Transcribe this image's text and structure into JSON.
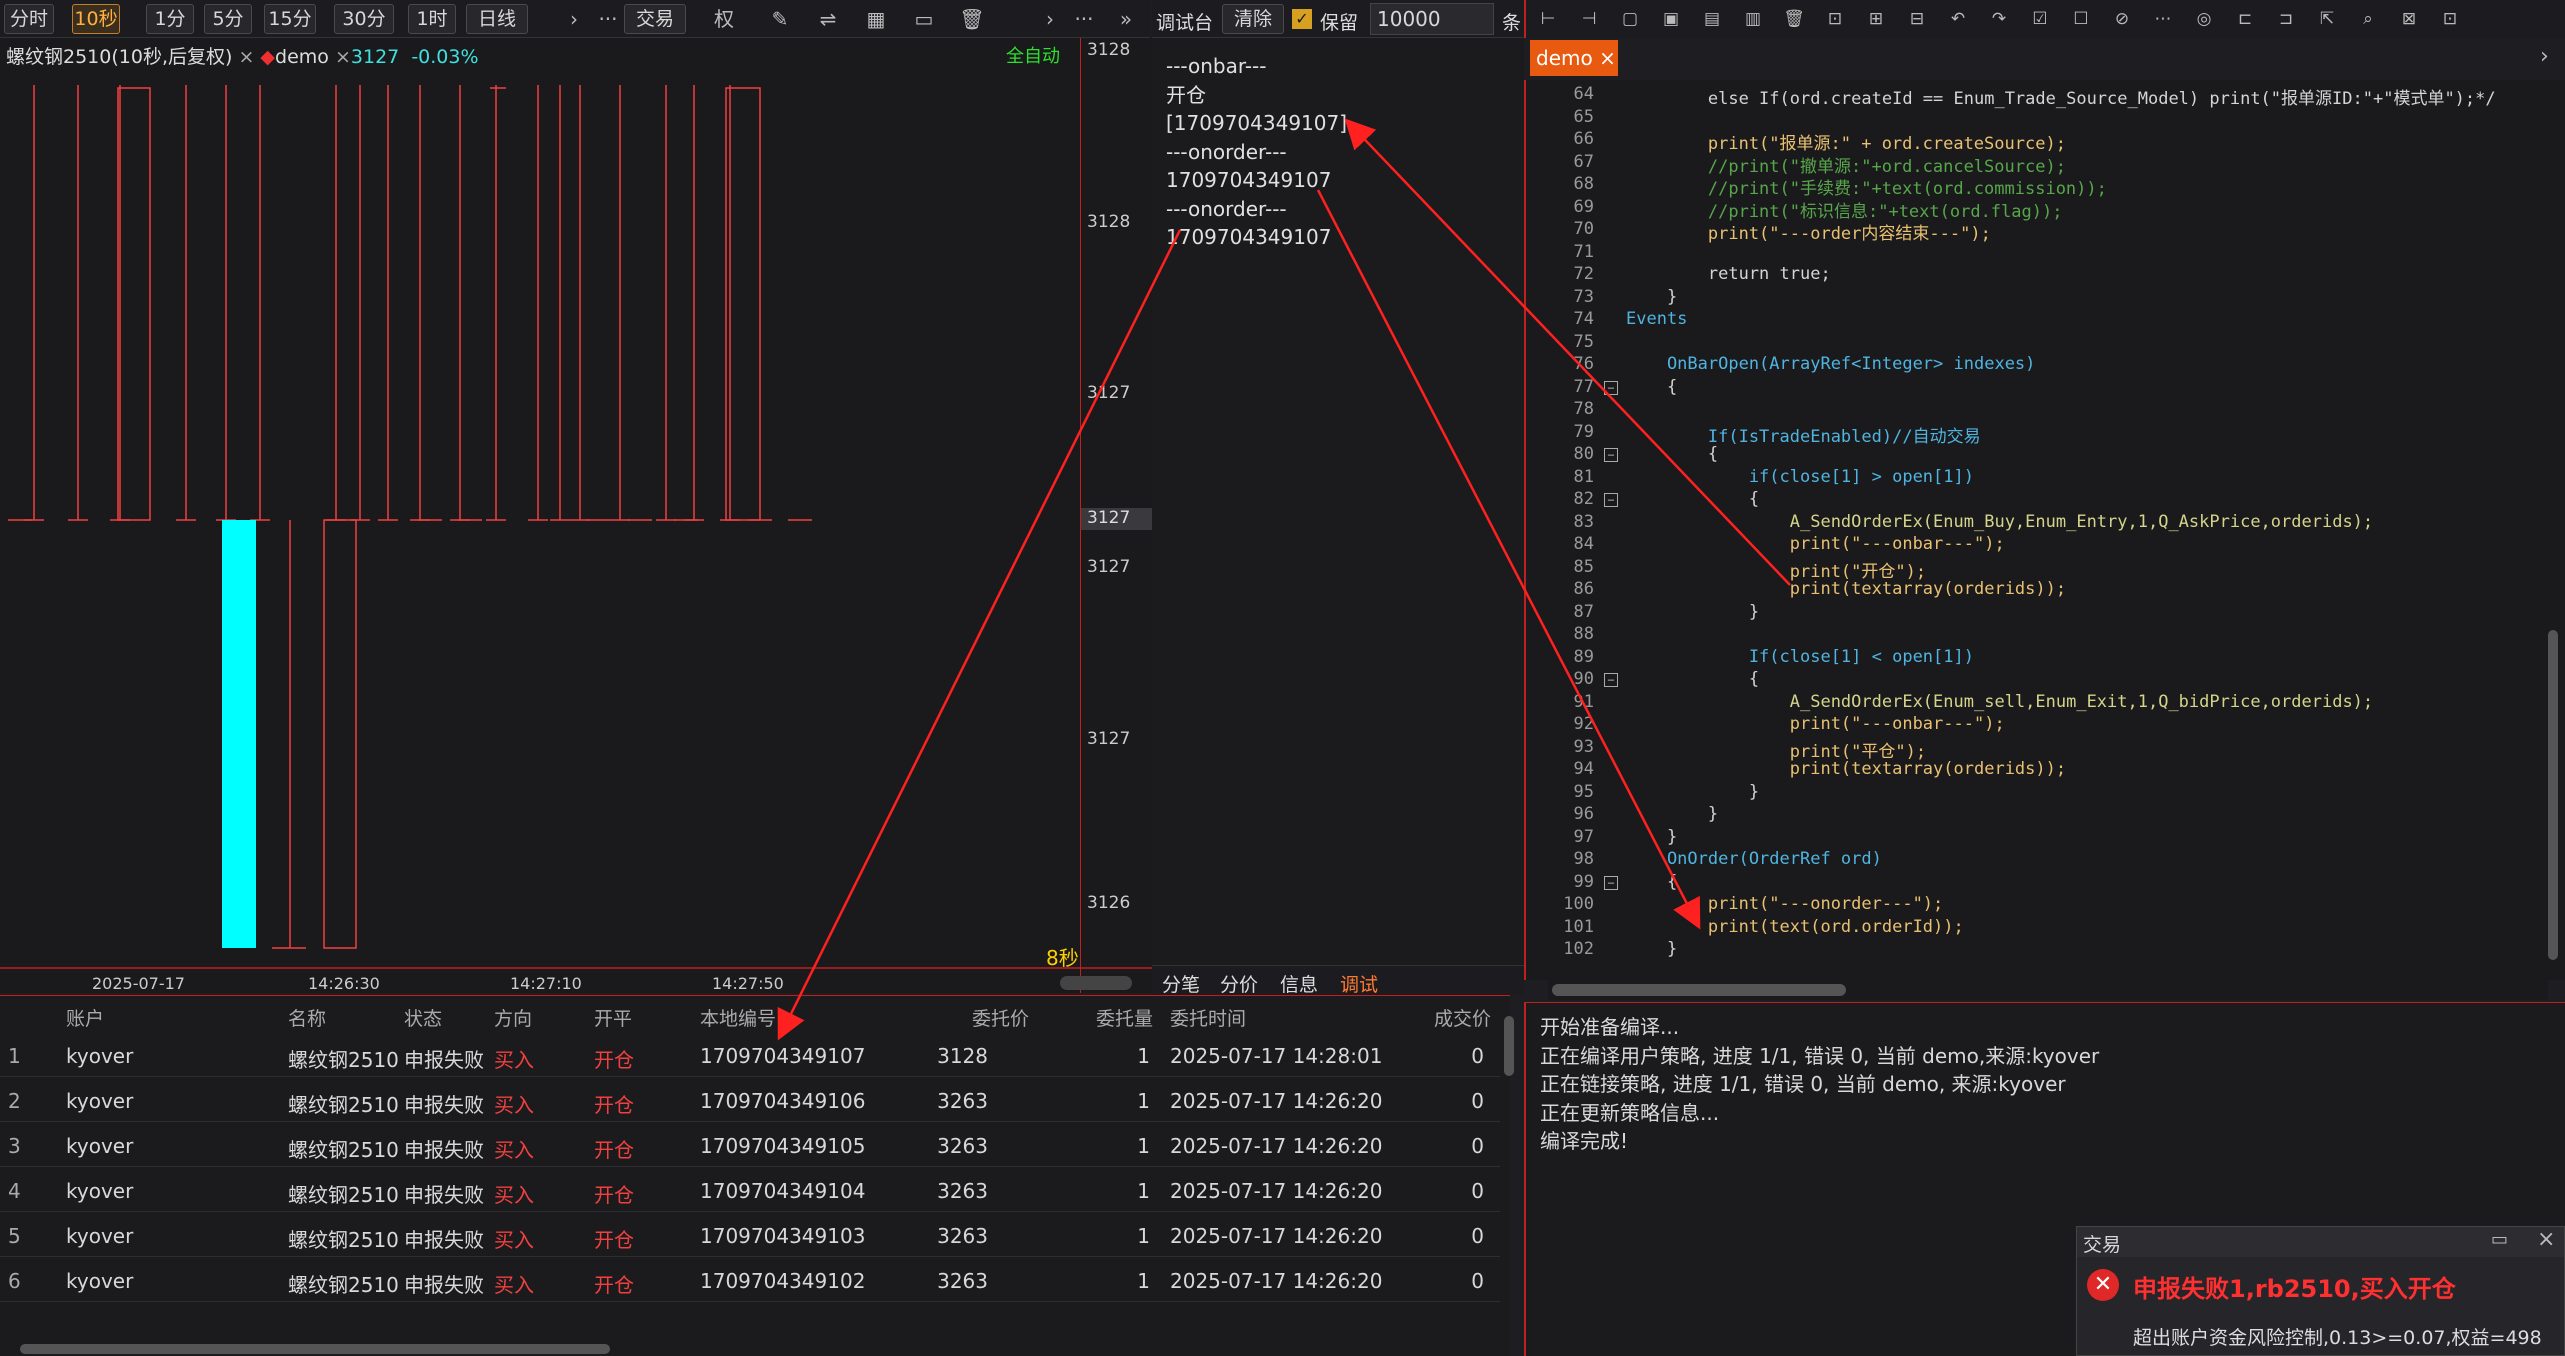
{
  "toolbar": {
    "periods": [
      "分时",
      "10秒",
      "1分",
      "5分",
      "15分",
      "30分",
      "1时",
      "日线"
    ],
    "active_period": "10秒",
    "trade_label": "交易",
    "rights_label": "权",
    "more": "···"
  },
  "chart": {
    "title": "螺纹钢2510(10秒,后复权)",
    "close": "×",
    "strategy": "demo",
    "price": "3127",
    "change": "-0.03%",
    "auto_label": "全自动",
    "timer": "8秒",
    "y_ticks": [
      "3128",
      "3128",
      "3127",
      "3127",
      "3127",
      "3126",
      "3126"
    ],
    "current_price": "3127",
    "x_ticks": [
      "2025-07-17",
      "14:26:30",
      "14:27:10",
      "14:27:50"
    ]
  },
  "debug": {
    "tab_label": "调试台",
    "clear_label": "清除",
    "keep_label": "保留",
    "keep_value": "10000",
    "unit_label": "条",
    "lines": [
      "---onbar---",
      "开仓",
      "[1709704349107]",
      "---onorder---",
      "1709704349107",
      "---onorder---",
      "1709704349107"
    ],
    "bottom_tabs": [
      "分笔",
      "分价",
      "信息",
      "调试"
    ]
  },
  "orders": {
    "headers": [
      "账户",
      "名称",
      "状态",
      "方向",
      "开平",
      "本地编号",
      "委托价",
      "委托量",
      "委托时间",
      "成交价"
    ],
    "rows": [
      {
        "idx": "1",
        "account": "kyover",
        "name": "螺纹钢2510",
        "status": "申报失败",
        "dir": "买入",
        "oc": "开仓",
        "local_id": "1709704349107",
        "price": "3128",
        "qty": "1",
        "time": "2025-07-17 14:28:01",
        "fill": "0"
      },
      {
        "idx": "2",
        "account": "kyover",
        "name": "螺纹钢2510",
        "status": "申报失败",
        "dir": "买入",
        "oc": "开仓",
        "local_id": "1709704349106",
        "price": "3263",
        "qty": "1",
        "time": "2025-07-17 14:26:20",
        "fill": "0"
      },
      {
        "idx": "3",
        "account": "kyover",
        "name": "螺纹钢2510",
        "status": "申报失败",
        "dir": "买入",
        "oc": "开仓",
        "local_id": "1709704349105",
        "price": "3263",
        "qty": "1",
        "time": "2025-07-17 14:26:20",
        "fill": "0"
      },
      {
        "idx": "4",
        "account": "kyover",
        "name": "螺纹钢2510",
        "status": "申报失败",
        "dir": "买入",
        "oc": "开仓",
        "local_id": "1709704349104",
        "price": "3263",
        "qty": "1",
        "time": "2025-07-17 14:26:20",
        "fill": "0"
      },
      {
        "idx": "5",
        "account": "kyover",
        "name": "螺纹钢2510",
        "status": "申报失败",
        "dir": "买入",
        "oc": "开仓",
        "local_id": "1709704349103",
        "price": "3263",
        "qty": "1",
        "time": "2025-07-17 14:26:20",
        "fill": "0"
      },
      {
        "idx": "6",
        "account": "kyover",
        "name": "螺纹钢2510",
        "status": "申报失败",
        "dir": "买入",
        "oc": "开仓",
        "local_id": "1709704349102",
        "price": "3263",
        "qty": "1",
        "time": "2025-07-17 14:26:20",
        "fill": "0"
      }
    ]
  },
  "editor": {
    "tab": "demo",
    "lines": [
      {
        "n": "64",
        "t": "        else If(ord.createId == Enum_Trade_Source_Model) print(\"报单源ID:\"+\"模式单\");*/"
      },
      {
        "n": "65",
        "t": ""
      },
      {
        "n": "66",
        "t": "        print(\"报单源:\" + ord.createSource);"
      },
      {
        "n": "67",
        "t": "        //print(\"撤单源:\"+ord.cancelSource);"
      },
      {
        "n": "68",
        "t": "        //print(\"手续费:\"+text(ord.commission));"
      },
      {
        "n": "69",
        "t": "        //print(\"标识信息:\"+text(ord.flag));"
      },
      {
        "n": "70",
        "t": "        print(\"---order内容结束---\");"
      },
      {
        "n": "71",
        "t": ""
      },
      {
        "n": "72",
        "t": "        return true;"
      },
      {
        "n": "73",
        "t": "    }"
      },
      {
        "n": "74",
        "t": "Events"
      },
      {
        "n": "75",
        "t": ""
      },
      {
        "n": "76",
        "t": "    OnBarOpen(ArrayRef<Integer> indexes)"
      },
      {
        "n": "77",
        "t": "    {"
      },
      {
        "n": "78",
        "t": ""
      },
      {
        "n": "79",
        "t": "        If(IsTradeEnabled)//自动交易"
      },
      {
        "n": "80",
        "t": "        {"
      },
      {
        "n": "81",
        "t": "            if(close[1] > open[1])"
      },
      {
        "n": "82",
        "t": "            {"
      },
      {
        "n": "83",
        "t": "                A_SendOrderEx(Enum_Buy,Enum_Entry,1,Q_AskPrice,orderids);"
      },
      {
        "n": "84",
        "t": "                print(\"---onbar---\");"
      },
      {
        "n": "85",
        "t": "                print(\"开仓\");"
      },
      {
        "n": "86",
        "t": "                print(textarray(orderids));"
      },
      {
        "n": "87",
        "t": "            }"
      },
      {
        "n": "88",
        "t": ""
      },
      {
        "n": "89",
        "t": "            If(close[1] < open[1])"
      },
      {
        "n": "90",
        "t": "            {"
      },
      {
        "n": "91",
        "t": "                A_SendOrderEx(Enum_sell,Enum_Exit,1,Q_bidPrice,orderids);"
      },
      {
        "n": "92",
        "t": "                print(\"---onbar---\");"
      },
      {
        "n": "93",
        "t": "                print(\"平仓\");"
      },
      {
        "n": "94",
        "t": "                print(textarray(orderids));"
      },
      {
        "n": "95",
        "t": "            }"
      },
      {
        "n": "96",
        "t": "        }"
      },
      {
        "n": "97",
        "t": "    }"
      },
      {
        "n": "98",
        "t": "    OnOrder(OrderRef ord)"
      },
      {
        "n": "99",
        "t": "    {"
      },
      {
        "n": "100",
        "t": "        print(\"---onorder---\");"
      },
      {
        "n": "101",
        "t": "        print(text(ord.orderId));"
      },
      {
        "n": "102",
        "t": "    }"
      }
    ]
  },
  "compile": {
    "lines": [
      "开始准备编译...",
      "正在编译用户策略, 进度 1/1, 错误 0, 当前 demo,来源:kyover",
      "正在链接策略, 进度 1/1, 错误 0, 当前 demo, 来源:kyover",
      "正在更新策略信息...",
      "编译完成!"
    ]
  },
  "trade_popup": {
    "title": "交易",
    "error": "申报失败1,rb2510,买入开仓",
    "detail": "超出账户资金风险控制,0.13>=0.07,权益=498"
  },
  "colors": {
    "accent": "#e85a10",
    "up": "#f04040",
    "down": "#00ffff",
    "auto": "#2ee02e"
  }
}
